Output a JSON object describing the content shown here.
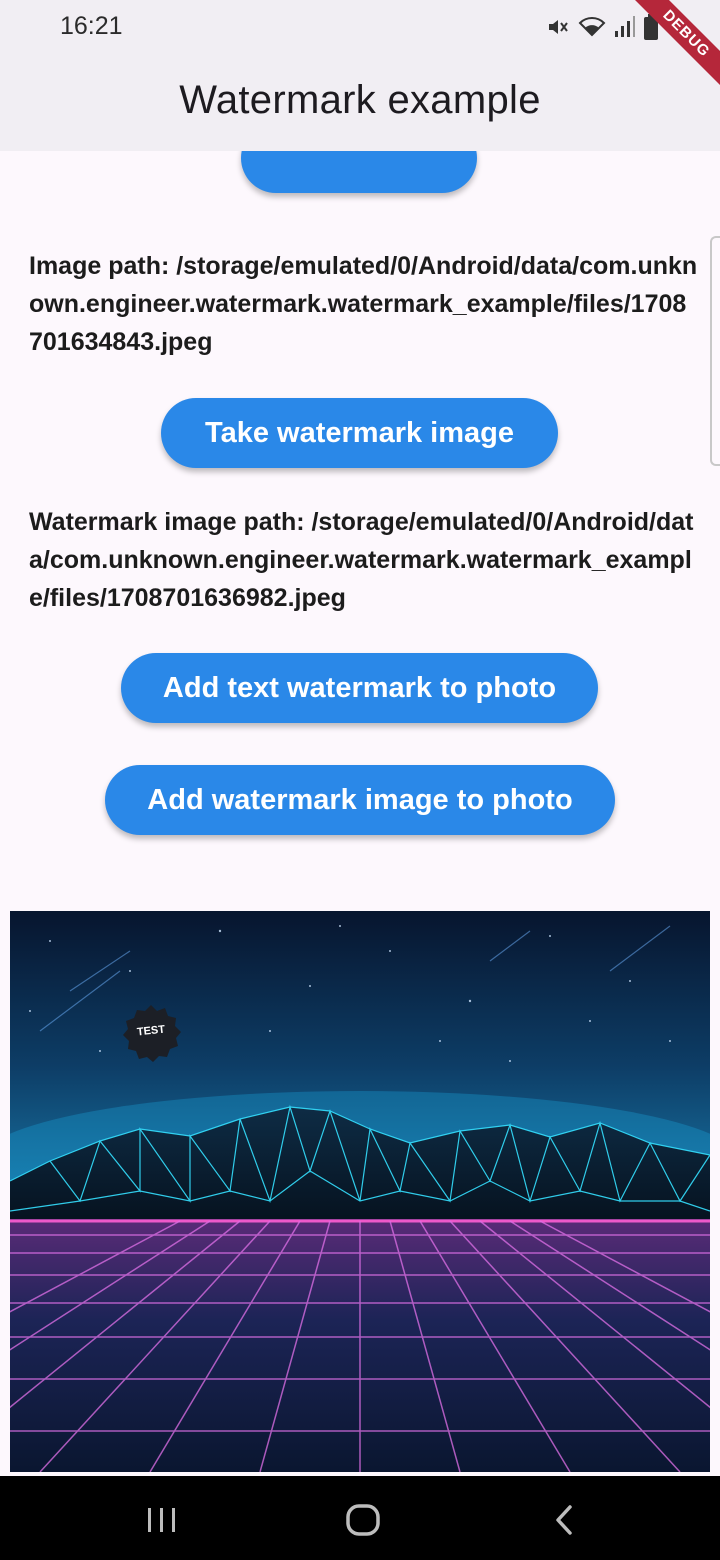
{
  "status_bar": {
    "time": "16:21",
    "icons": [
      "mute-icon",
      "wifi-icon",
      "signal-icon",
      "battery-icon"
    ]
  },
  "debug_banner": "DEBUG",
  "app_bar": {
    "title": "Watermark example"
  },
  "content": {
    "image_path_text": "Image path: /storage/emulated/0/Android/data/com.unknown.engineer.watermark.watermark_example/files/1708701634843.jpeg",
    "take_watermark_button": "Take watermark image",
    "watermark_path_text": "Watermark image path: /storage/emulated/0/Android/data/com.unknown.engineer.watermark.watermark_example/files/1708701636982.jpeg",
    "add_text_button": "Add text watermark to photo",
    "add_image_button": "Add watermark image to photo",
    "watermark_badge_text": "TEST"
  },
  "colors": {
    "button": "#2a88e8",
    "app_bar": "#f1eef3",
    "background": "#fdf8fd",
    "debug": "#b5273a"
  },
  "nav_bar": {
    "icons": [
      "recents-icon",
      "home-icon",
      "back-icon"
    ]
  }
}
